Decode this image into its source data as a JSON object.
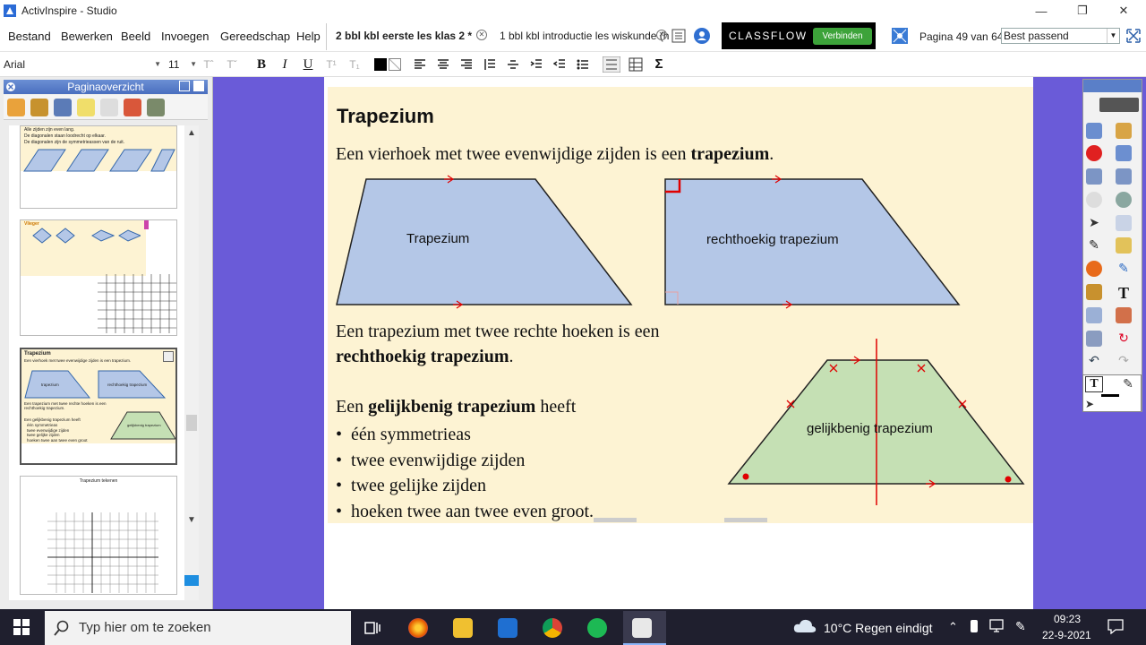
{
  "window": {
    "title": "ActivInspire - Studio"
  },
  "menu": [
    "Bestand",
    "Bewerken",
    "Beeld",
    "Invoegen",
    "Gereedschap",
    "Help"
  ],
  "tabs": [
    {
      "label": "2 bbl kbl eerste les klas 2  *"
    },
    {
      "label": "1 bbl kbl introductie les wiskunde (h"
    }
  ],
  "classflow": {
    "logo": "CLASSFLOW",
    "connect": "Verbinden"
  },
  "page_info": "Pagina 49 van 64",
  "zoom": "Best passend",
  "format": {
    "font": "Arial",
    "size": "11"
  },
  "panel": {
    "title": "Paginaoverzicht"
  },
  "thumbnails": {
    "t1_lines": [
      "Alle zijden zijn even lang.",
      "De diagonalen staan loodrecht op elkaar.",
      "De diagonalen zijn de symmetrieassen van de ruit."
    ],
    "t2_title": "Vlieger",
    "t3_title": "Trapezium",
    "t3_line1": "Een vierhoek met twee evenwijdige zijden is een trapezium.",
    "t3_shape1": "trapezium",
    "t3_shape2": "rechthoekig trapezium",
    "t3_line2": "Een trapezium met twee rechte hoeken is een rechthoekig trapezium.",
    "t3_shape3": "gelijkbenig trapezium",
    "t3_line3": "Een gelijkbenig trapezium heeft",
    "t3_bullets": [
      "één symmetrieas",
      "twee evenwijdige zijden",
      "twee gelijke zijden",
      "hoeken twee aan twee even groot"
    ],
    "t4_title": "Trapezium tekenen"
  },
  "slide": {
    "title": "Trapezium",
    "intro": "Een vierhoek met twee evenwijdige zijden is een",
    "intro_bold": "trapezium",
    "shape1_label": "Trapezium",
    "shape2_label": "rechthoekig trapezium",
    "shape3_label": "gelijkbenig trapezium",
    "line2": "Een trapezium met twee rechte hoeken is een",
    "line2_bold": "rechthoekig trapezium",
    "line3_start": "Een",
    "line3_bold": "gelijkbenig trapezium",
    "line3_end": "heeft",
    "bullets": [
      "één symmetrieas",
      "twee evenwijdige zijden",
      "twee gelijke zijden",
      "hoeken twee aan twee even groot."
    ],
    "colors": {
      "blue": "#b4c7e7",
      "green": "#c5e0b4",
      "red": "#e00000",
      "bg": "#fdf3d3"
    }
  },
  "taskbar": {
    "search_placeholder": "Typ hier om te zoeken",
    "weather": "10°C  Regen eindigt",
    "time": "09:23",
    "date": "22-9-2021"
  }
}
